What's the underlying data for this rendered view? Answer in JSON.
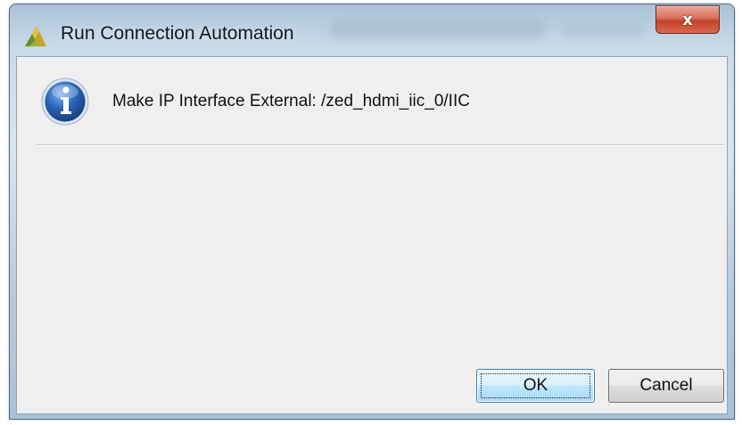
{
  "window": {
    "title": "Run Connection Automation",
    "close_label": "x",
    "app_icon": "vivado-logo-icon"
  },
  "dialog": {
    "icon": "info-icon",
    "message": "Make IP Interface External: /zed_hdmi_iic_0/IIC"
  },
  "buttons": {
    "ok_label": "OK",
    "cancel_label": "Cancel"
  },
  "colors": {
    "client_background": "#efefef",
    "close_button": "#c4402a",
    "ok_button_border": "#3c7fb1",
    "info_icon_blue": "#2a63b8"
  }
}
